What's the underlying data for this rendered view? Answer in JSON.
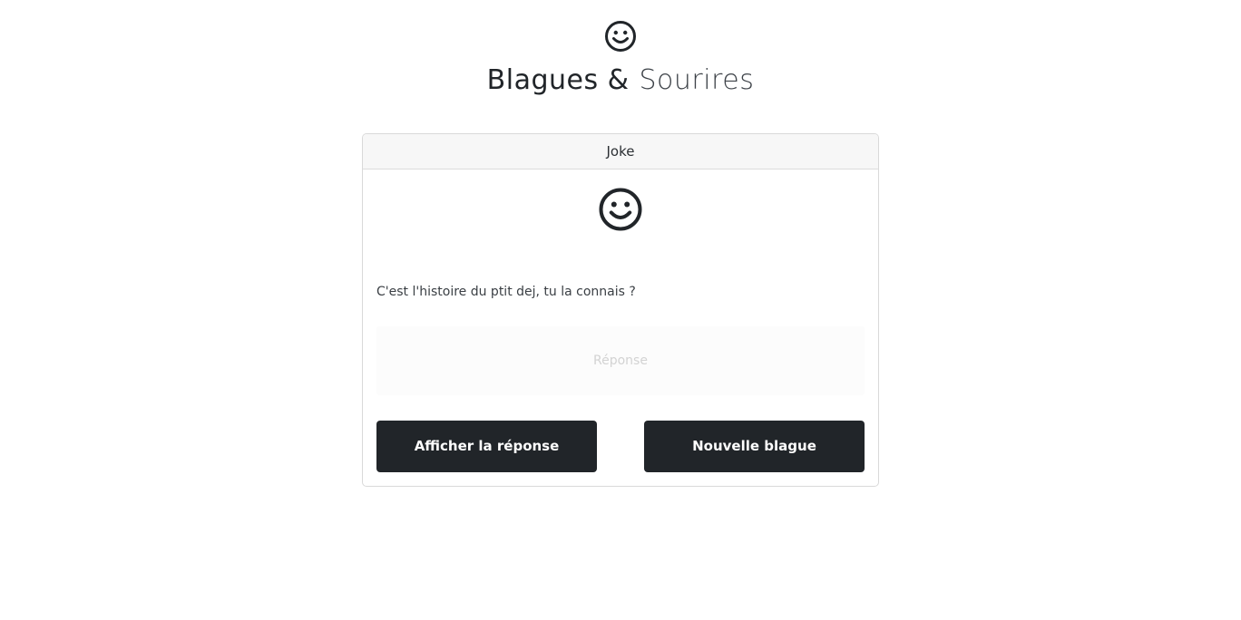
{
  "header": {
    "logo_icon": "smiley-icon",
    "title_strong": "Blagues &",
    "title_light": "Sourires"
  },
  "card": {
    "header_label": "Joke",
    "icon": "smiley-icon",
    "question": "C'est l'histoire du ptit dej, tu la connais ?",
    "answer_placeholder": "Réponse",
    "show_answer_label": "Afficher la réponse",
    "new_joke_label": "Nouvelle blague"
  },
  "colors": {
    "button_bg": "#212529",
    "button_text": "#ffffff",
    "card_header_bg": "#f7f7f7",
    "card_border": "#d9d9d9"
  }
}
